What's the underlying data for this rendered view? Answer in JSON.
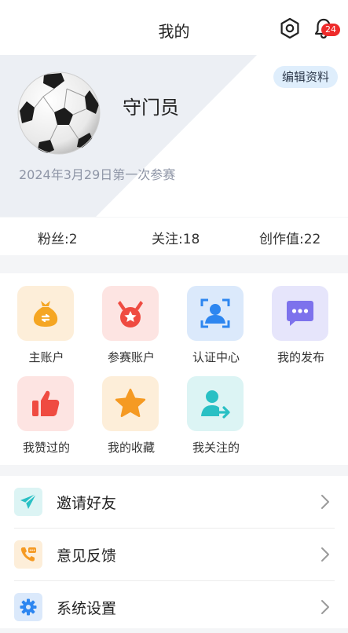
{
  "header": {
    "title": "我的",
    "notification_count": "24"
  },
  "profile": {
    "nickname": "守门员",
    "edit_label": "编辑资料",
    "join_date": "2024年3月29日第一次参赛"
  },
  "stats": [
    {
      "label": "粉丝:2"
    },
    {
      "label": "关注:18"
    },
    {
      "label": "创作值:22"
    }
  ],
  "grid": [
    {
      "label": "主账户",
      "icon": "money-bag-icon",
      "bg": "#fdeed9",
      "color": "#f5a623"
    },
    {
      "label": "参赛账户",
      "icon": "medal-icon",
      "bg": "#fde4e2",
      "color": "#ef4b41"
    },
    {
      "label": "认证中心",
      "icon": "face-scan-icon",
      "bg": "#dbe9fb",
      "color": "#2d86f0"
    },
    {
      "label": "我的发布",
      "icon": "chat-bubble-icon",
      "bg": "#e6e5fb",
      "color": "#7d72ec"
    },
    {
      "label": "我赞过的",
      "icon": "thumbs-up-icon",
      "bg": "#fde4e2",
      "color": "#ef4b41"
    },
    {
      "label": "我的收藏",
      "icon": "star-icon",
      "bg": "#fdeed9",
      "color": "#f59a23"
    },
    {
      "label": "我关注的",
      "icon": "user-follow-icon",
      "bg": "#dcf4f4",
      "color": "#29c0c4"
    }
  ],
  "menu": [
    {
      "label": "邀请好友",
      "icon": "paper-plane-icon"
    },
    {
      "label": "意见反馈",
      "icon": "feedback-phone-icon"
    },
    {
      "label": "系统设置",
      "icon": "gear-icon"
    }
  ]
}
